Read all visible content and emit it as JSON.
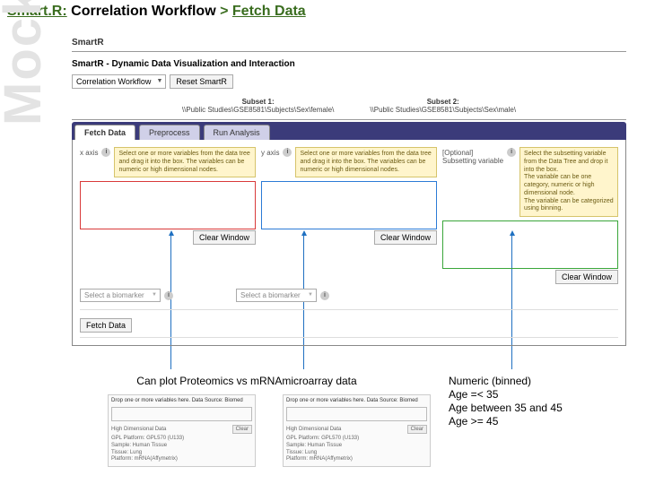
{
  "breadcrumb": {
    "app": "Smart.R:",
    "root": "Correlation Workflow",
    "sep": ">",
    "current": "Fetch Data"
  },
  "watermark": "Mockup",
  "header": {
    "logo": "SmartR",
    "subtitle": "SmartR - Dynamic Data Visualization and Interaction",
    "workflow_select": "Correlation Workflow",
    "reset_label": "Reset SmartR"
  },
  "subsets": {
    "s1_label": "Subset 1:",
    "s1_path": "\\\\Public Studies\\GSE8581\\Subjects\\Sex\\female\\",
    "s2_label": "Subset 2:",
    "s2_path": "\\\\Public Studies\\GSE8581\\Subjects\\Sex\\male\\"
  },
  "tabs": {
    "fetch": "Fetch Data",
    "preprocess": "Preprocess",
    "run": "Run Analysis"
  },
  "dropzones": {
    "x_label": "x axis",
    "y_label": "y axis",
    "s_label_1": "[Optional]",
    "s_label_2": "Subsetting variable",
    "tooltip_xy": "Select one or more variables from the data tree and drag it into the box. The variables can be numeric or high dimensional nodes.",
    "tooltip_s": "Select the subsetting variable from the Data Tree and drop it into the box.\nThe variable can be one category, numeric or high dimensional node.\nThe variable can be categorized using binning.",
    "clear_label": "Clear Window"
  },
  "biomarker": {
    "placeholder": "Select a biomarker"
  },
  "fetch_button": "Fetch Data",
  "annotations": {
    "left": "Can plot Proteomics vs mRNAmicroarray data",
    "right_lines": [
      "Numeric (binned)",
      "Age =< 35",
      "Age between 35 and 45",
      "Age >= 45"
    ]
  },
  "crops": {
    "hdr": "Drop one or more variables here. Data Source: Biomed",
    "hd_label": "High Dimensional Data",
    "clear": "Clear",
    "foot1": "GPL Platform: GPL570 (U133)",
    "foot2": "Sample: Human Tissue",
    "foot3": "Tissue: Lung",
    "foot4": "Platform: mRNA(Affymetrix)"
  }
}
